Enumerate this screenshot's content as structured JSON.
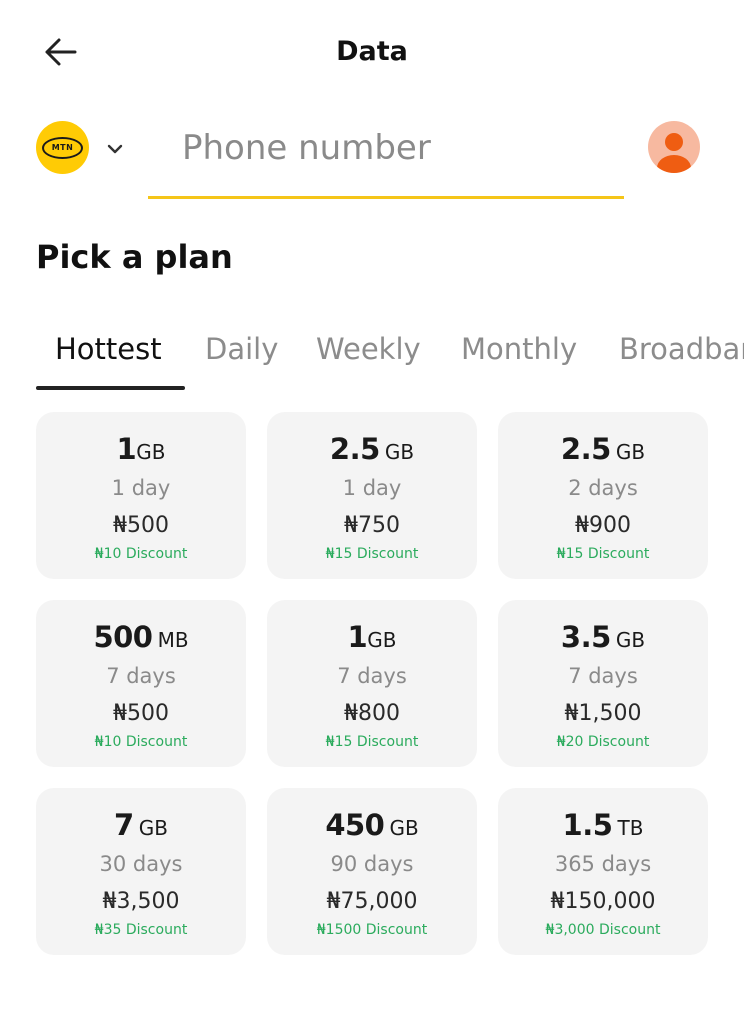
{
  "header": {
    "title": "Data",
    "back_icon": "arrow-left-icon"
  },
  "carrier": {
    "logo_text": "MTN",
    "logo_color": "#ffcb05",
    "dropdown_icon": "chevron-down-icon"
  },
  "phone": {
    "placeholder": "Phone number",
    "value": "",
    "underline_color": "#f5c518"
  },
  "section": {
    "title": "Pick a plan"
  },
  "tabs": [
    {
      "label": "Hottest",
      "active": true
    },
    {
      "label": "Daily",
      "active": false
    },
    {
      "label": "Weekly",
      "active": false
    },
    {
      "label": "Monthly",
      "active": false
    },
    {
      "label": "Broadbar",
      "active": false
    }
  ],
  "plans": [
    {
      "amount": "1",
      "unit": "GB",
      "duration": "1 day",
      "price": "₦500",
      "discount": "₦10 Discount"
    },
    {
      "amount": "2.5",
      "unit": "GB",
      "duration": "1 day",
      "price": "₦750",
      "discount": "₦15 Discount"
    },
    {
      "amount": "2.5",
      "unit": "GB",
      "duration": "2 days",
      "price": "₦900",
      "discount": "₦15 Discount"
    },
    {
      "amount": "500",
      "unit": "MB",
      "duration": "7 days",
      "price": "₦500",
      "discount": "₦10 Discount"
    },
    {
      "amount": "1",
      "unit": "GB",
      "duration": "7 days",
      "price": "₦800",
      "discount": "₦15 Discount"
    },
    {
      "amount": "3.5",
      "unit": "GB",
      "duration": "7 days",
      "price": "₦1,500",
      "discount": "₦20 Discount"
    },
    {
      "amount": "7",
      "unit": "GB",
      "duration": "30 days",
      "price": "₦3,500",
      "discount": "₦35 Discount"
    },
    {
      "amount": "450",
      "unit": "GB",
      "duration": "90 days",
      "price": "₦75,000",
      "discount": "₦1500 Discount"
    },
    {
      "amount": "1.5",
      "unit": "TB",
      "duration": "365 days",
      "price": "₦150,000",
      "discount": "₦3,000 Discount"
    }
  ],
  "colors": {
    "accent": "#f5c518",
    "discount": "#2bab5d",
    "card_bg": "#f4f4f4",
    "avatar_bg": "#f7b9a0",
    "avatar_fg": "#ef5d12"
  }
}
